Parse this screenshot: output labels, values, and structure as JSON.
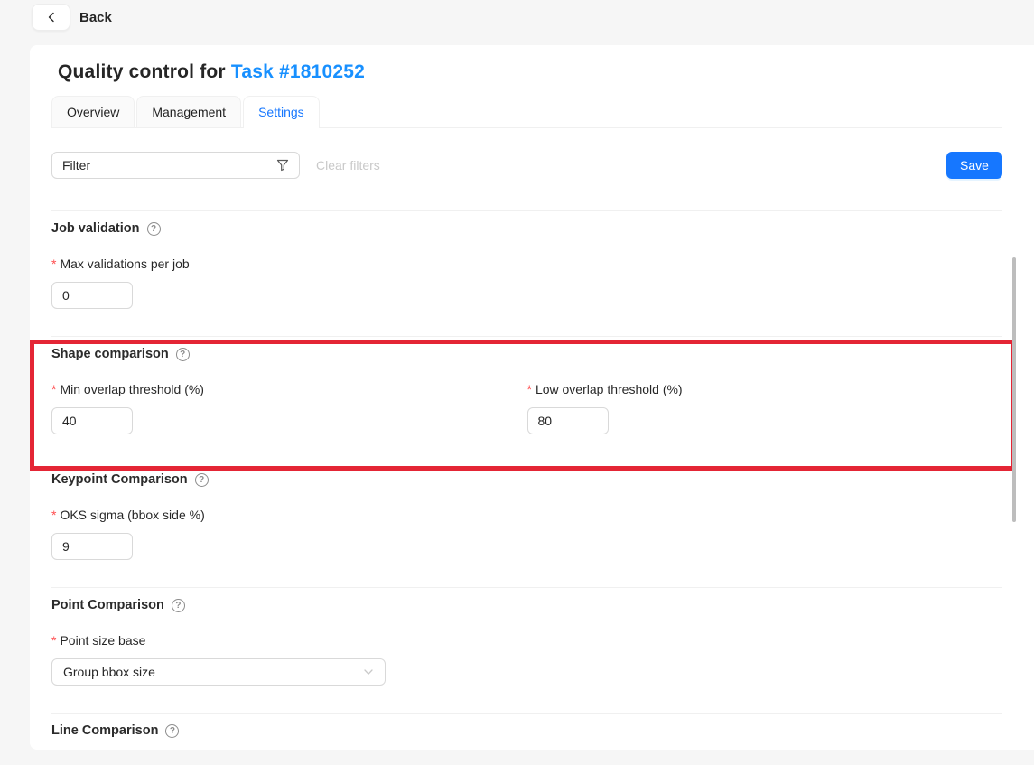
{
  "topbar": {
    "back_label": "Back"
  },
  "header": {
    "title_prefix": "Quality control for ",
    "title_link": "Task #1810252"
  },
  "tabs": [
    {
      "label": "Overview",
      "active": false
    },
    {
      "label": "Management",
      "active": false
    },
    {
      "label": "Settings",
      "active": true
    }
  ],
  "toolbar": {
    "filter_label": "Filter",
    "clear_filters_label": "Clear filters",
    "save_label": "Save"
  },
  "ui": {
    "required_marker": "*",
    "help_glyph": "?"
  },
  "sections": [
    {
      "title": "Job validation",
      "fields": [
        {
          "label": "Max validations per job",
          "value": "0",
          "type": "input"
        }
      ]
    },
    {
      "title": "Shape comparison",
      "highlighted": true,
      "fields": [
        {
          "label": "Min overlap threshold (%)",
          "value": "40",
          "type": "input"
        },
        {
          "label": "Low overlap threshold (%)",
          "value": "80",
          "type": "input"
        }
      ]
    },
    {
      "title": "Keypoint Comparison",
      "fields": [
        {
          "label": "OKS sigma (bbox side %)",
          "value": "9",
          "type": "input"
        }
      ]
    },
    {
      "title": "Point Comparison",
      "fields": [
        {
          "label": "Point size base",
          "value": "Group bbox size",
          "type": "select"
        }
      ]
    },
    {
      "title": "Line Comparison",
      "fields": []
    }
  ],
  "colors": {
    "accent_blue": "#1677ff",
    "link_blue": "#1890ff",
    "highlight_red": "#e42535",
    "required_red": "#ff4d4f"
  }
}
